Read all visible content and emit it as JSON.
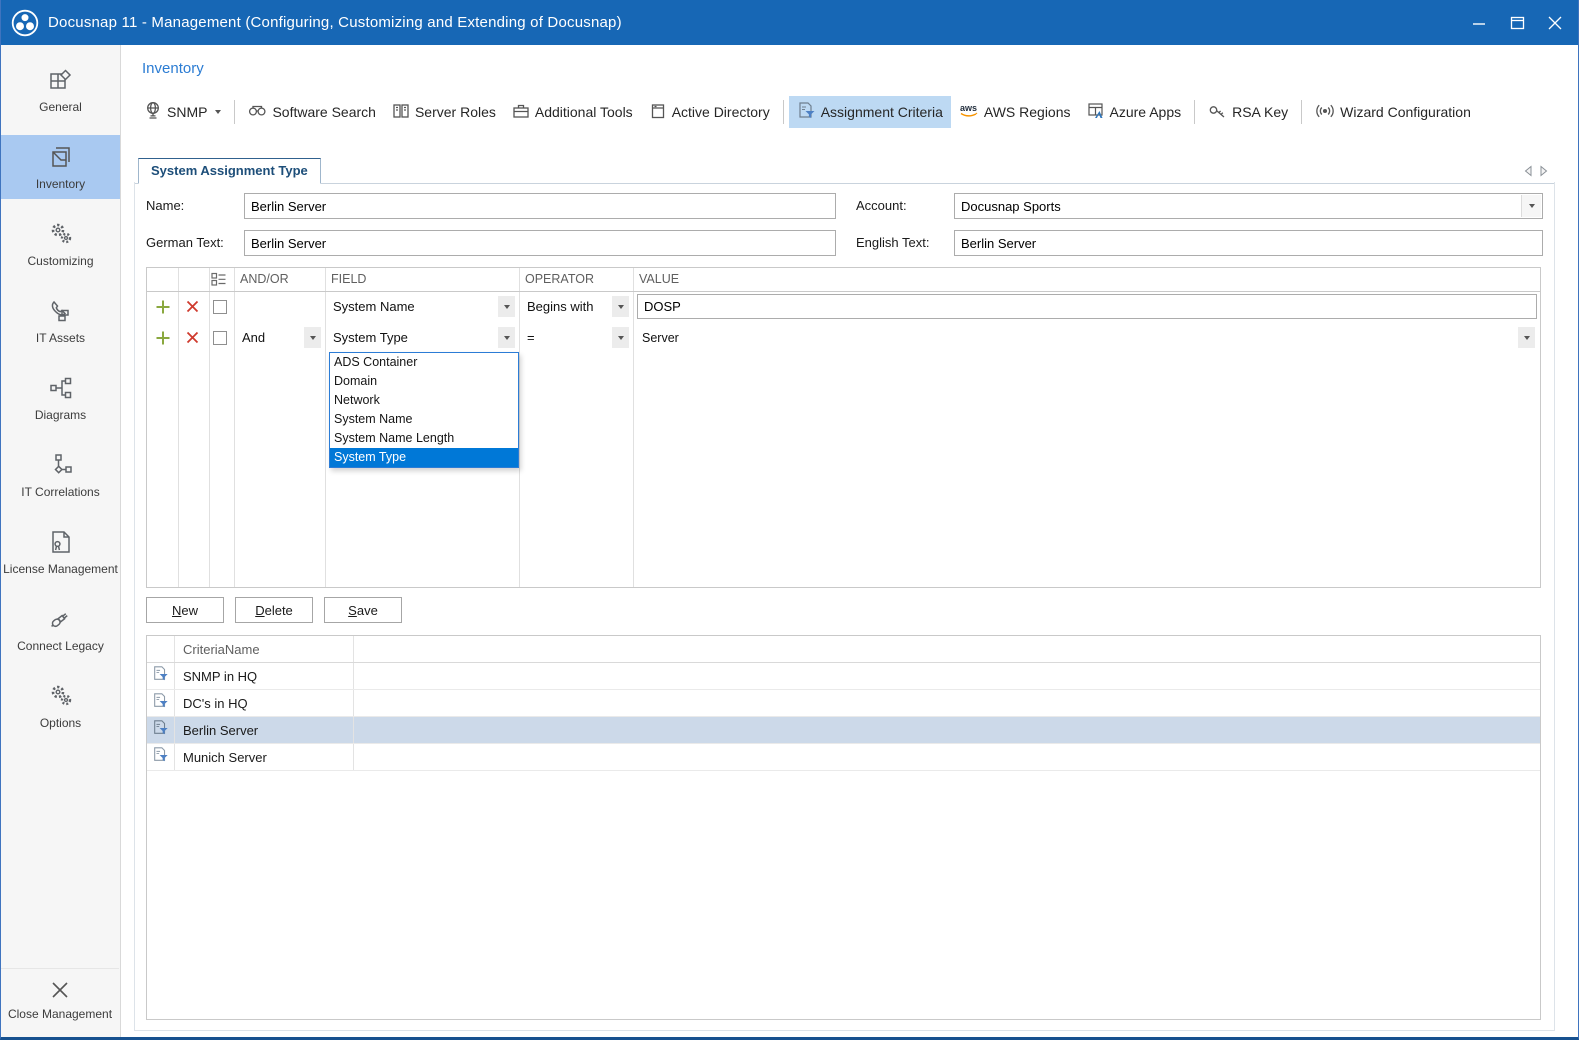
{
  "window": {
    "title": "Docusnap 11 - Management (Configuring, Customizing and Extending of Docusnap)"
  },
  "colors": {
    "titlebar": "#1767b5",
    "accent_blue": "#2b7cd3",
    "sidebar_selected": "#a9c9f1",
    "toolbar_selected": "#bdd9f3",
    "dropdown_highlight": "#0078d7",
    "row_selected": "#ccd9e9"
  },
  "sidebar": {
    "items": [
      {
        "label": "General"
      },
      {
        "label": "Inventory"
      },
      {
        "label": "Customizing"
      },
      {
        "label": "IT Assets"
      },
      {
        "label": "Diagrams"
      },
      {
        "label": "IT Correlations"
      },
      {
        "label": "License Management"
      },
      {
        "label": "Connect Legacy"
      },
      {
        "label": "Options"
      }
    ],
    "close_label": "Close Management"
  },
  "header": {
    "breadcrumb": "Inventory"
  },
  "toolbar": {
    "items": [
      {
        "label": "SNMP"
      },
      {
        "label": "Software Search"
      },
      {
        "label": "Server Roles"
      },
      {
        "label": "Additional Tools"
      },
      {
        "label": "Active Directory"
      },
      {
        "label": "Assignment Criteria"
      },
      {
        "label": "AWS Regions"
      },
      {
        "label": "Azure Apps"
      },
      {
        "label": "RSA Key"
      },
      {
        "label": "Wizard Configuration"
      }
    ]
  },
  "tabs": {
    "active": "System Assignment Type"
  },
  "form": {
    "name": {
      "label": "Name:",
      "value": "Berlin Server"
    },
    "account": {
      "label": "Account:",
      "value": "Docusnap Sports"
    },
    "german": {
      "label": "German Text:",
      "value": "Berlin Server"
    },
    "english": {
      "label": "English Text:",
      "value": "Berlin Server"
    }
  },
  "criteria_grid": {
    "headers": {
      "andor": "AND/OR",
      "field": "FIELD",
      "operator": "OPERATOR",
      "value": "VALUE"
    },
    "rows": [
      {
        "andor": "",
        "field": "System Name",
        "operator": "Begins with",
        "value": "DOSP"
      },
      {
        "andor": "And",
        "field": "System Type",
        "operator": "=",
        "value": "Server"
      }
    ]
  },
  "field_dropdown": {
    "options": [
      "ADS Container",
      "Domain",
      "Network",
      "System Name",
      "System Name Length",
      "System Type"
    ],
    "selected": "System Type"
  },
  "actions": {
    "new": {
      "accel": "N",
      "rest": "ew"
    },
    "delete": {
      "accel": "D",
      "rest": "elete"
    },
    "save": {
      "accel": "S",
      "rest": "ave"
    }
  },
  "criteria_table": {
    "header": "CriteriaName",
    "rows": [
      {
        "name": "SNMP in HQ"
      },
      {
        "name": "DC's in HQ"
      },
      {
        "name": "Berlin Server",
        "selected": true
      },
      {
        "name": "Munich Server"
      }
    ]
  }
}
